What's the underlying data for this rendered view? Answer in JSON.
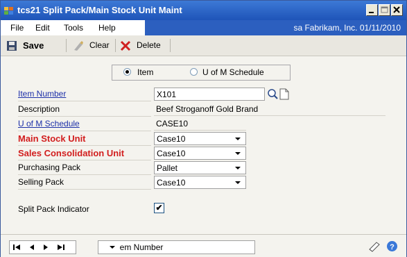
{
  "window": {
    "title": "tcs21 Split Pack/Main Stock Unit Maint"
  },
  "menu": {
    "items": [
      "File",
      "Edit",
      "Tools",
      "Help"
    ],
    "company_info": "sa  Fabrikam, Inc.  01/11/2010"
  },
  "toolbar": {
    "save_label": "Save",
    "clear_label": "Clear",
    "delete_label": "Delete"
  },
  "view_mode": {
    "options": [
      "Item",
      "U of M Schedule"
    ],
    "selected": "Item"
  },
  "form": {
    "item_number_label": "Item Number",
    "item_number_value": "X101",
    "description_label": "Description",
    "description_value": "Beef Stroganoff Gold Brand",
    "uofm_schedule_label": "U of M Schedule",
    "uofm_schedule_value": "CASE10",
    "main_stock_unit_label": "Main Stock Unit",
    "main_stock_unit_value": "Case10",
    "sales_consolidation_label": "Sales Consolidation Unit",
    "sales_consolidation_value": "Case10",
    "purchasing_pack_label": "Purchasing Pack",
    "purchasing_pack_value": "Pallet",
    "selling_pack_label": "Selling Pack",
    "selling_pack_value": "Case10",
    "split_pack_label": "Split Pack Indicator",
    "split_pack_checked": true
  },
  "bottom": {
    "sort_value": "by Item Number"
  },
  "colors": {
    "title_bar": "#1e54b8",
    "required_label": "#d21e1e",
    "link_label": "#1c2fa8"
  }
}
